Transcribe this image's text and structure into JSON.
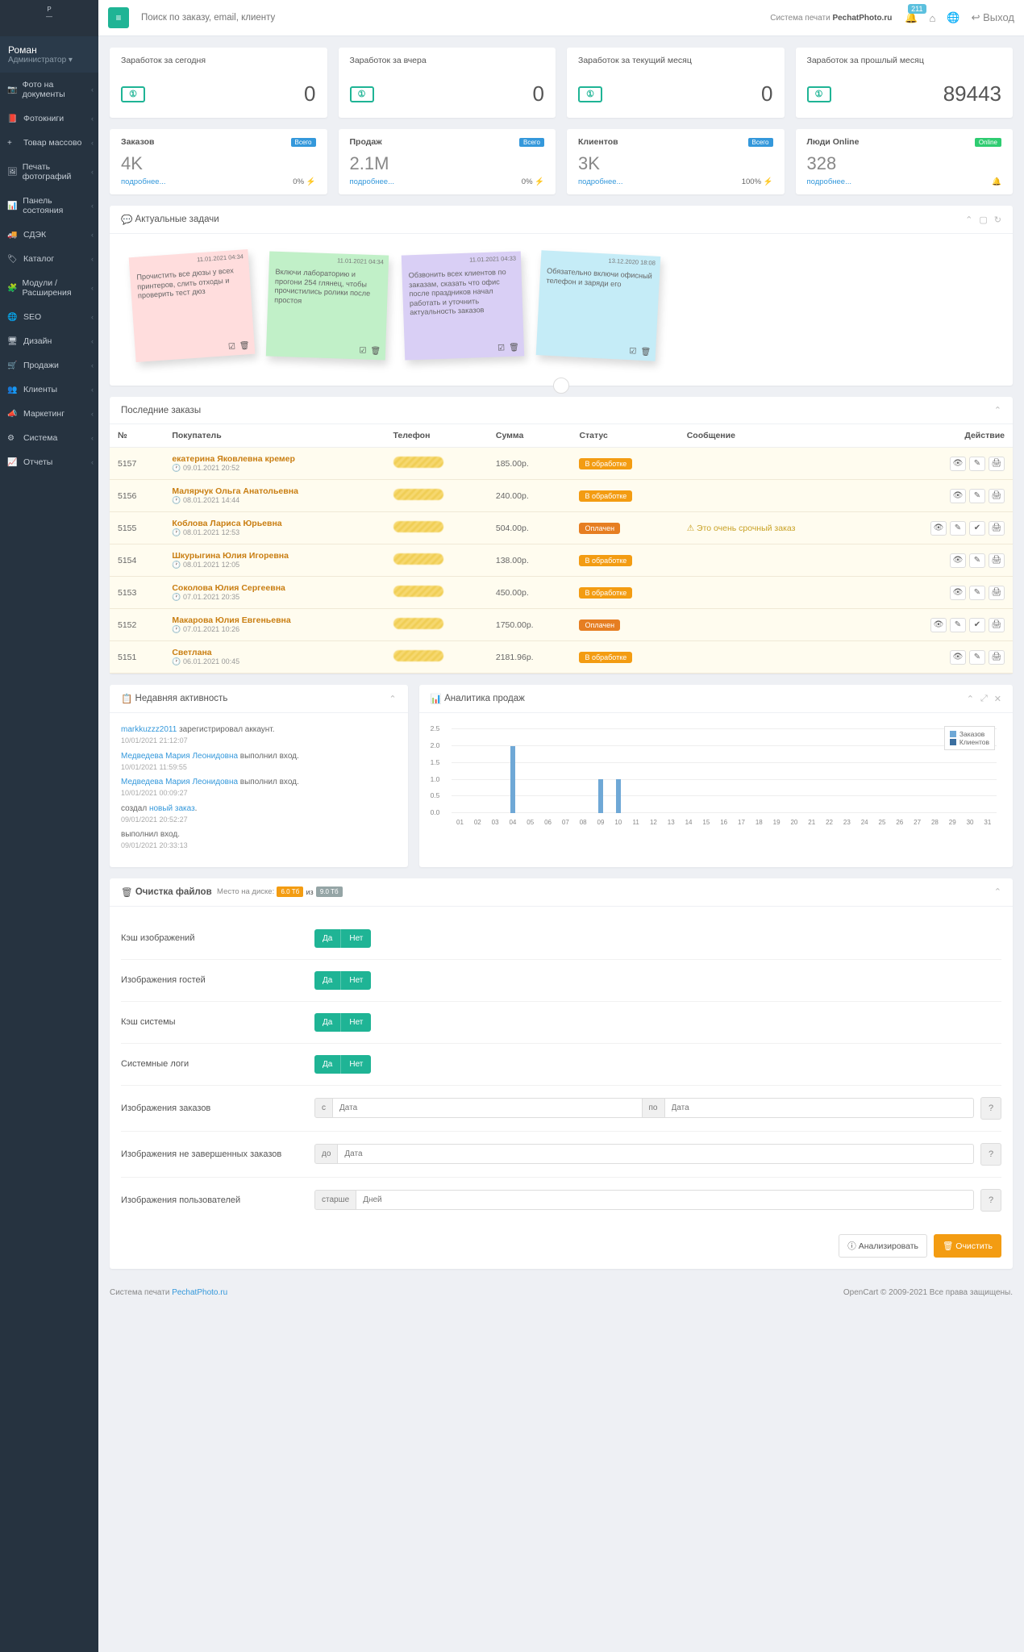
{
  "header": {
    "search_placeholder": "Поиск по заказу, email, клиенту",
    "system_label": "Система печати",
    "site": "PechatPhoto.ru",
    "notif_count": "211",
    "logout": "Выход"
  },
  "sidebar": {
    "user_name": "Роман",
    "user_role": "Администратор",
    "items": [
      {
        "label": "Фото на документы"
      },
      {
        "label": "Фотокниги"
      },
      {
        "label": "Товар массово"
      },
      {
        "label": "Печать фотографий"
      },
      {
        "label": "Панель состояния"
      },
      {
        "label": "СДЭК"
      },
      {
        "label": "Каталог"
      },
      {
        "label": "Модули / Расширения"
      },
      {
        "label": "SEO"
      },
      {
        "label": "Дизайн"
      },
      {
        "label": "Продажи"
      },
      {
        "label": "Клиенты"
      },
      {
        "label": "Маркетинг"
      },
      {
        "label": "Система"
      },
      {
        "label": "Отчеты"
      }
    ]
  },
  "stats_money": [
    {
      "title": "Заработок за сегодня",
      "value": "0"
    },
    {
      "title": "Заработок за вчера",
      "value": "0"
    },
    {
      "title": "Заработок за текущий месяц",
      "value": "0"
    },
    {
      "title": "Заработок за прошлый месяц",
      "value": "89443"
    }
  ],
  "stats_meta": [
    {
      "title": "Заказов",
      "chip": "Всего",
      "chip_cls": "chip-blue",
      "value": "4K",
      "more": "подробнее...",
      "pct": "0%"
    },
    {
      "title": "Продаж",
      "chip": "Всего",
      "chip_cls": "chip-blue",
      "value": "2.1M",
      "more": "подробнее...",
      "pct": "0%"
    },
    {
      "title": "Клиентов",
      "chip": "Всего",
      "chip_cls": "chip-blue",
      "value": "3K",
      "more": "подробнее...",
      "pct": "100%"
    },
    {
      "title": "Люди Online",
      "chip": "Online",
      "chip_cls": "chip-green",
      "value": "328",
      "more": "подробнее...",
      "pct": ""
    }
  ],
  "tasks": {
    "title": "Актуальные задачи",
    "notes": [
      {
        "cls": "r",
        "date": "11.01.2021 04:34",
        "text": "Прочистить все дюзы у всех принтеров, слить отходы и проверить тест дюз"
      },
      {
        "cls": "g",
        "date": "11.01.2021 04:34",
        "text": "Включи лабораторию и прогони 254 глянец, чтобы прочистились ролики после простоя"
      },
      {
        "cls": "p",
        "date": "11.01.2021 04:33",
        "text": "Обзвонить всех клиентов по заказам, сказать что офис после праздников начал работать и уточнить актуальность заказов"
      },
      {
        "cls": "b",
        "date": "13.12.2020 18:08",
        "text": "Обязательно включи офисный телефон и заряди его"
      }
    ]
  },
  "orders": {
    "title": "Последние заказы",
    "cols": [
      "№",
      "Покупатель",
      "Телефон",
      "Сумма",
      "Статус",
      "Сообщение",
      "Действие"
    ],
    "rows": [
      {
        "n": "5157",
        "cust": "екатерина Яковлевна кремер",
        "dt": "09.01.2021 20:52",
        "sum": "185.00р.",
        "st": "В обработке",
        "st_cls": "st-proc",
        "msg": "",
        "extra": false
      },
      {
        "n": "5156",
        "cust": "Малярчук Ольга Анатольевна",
        "dt": "08.01.2021 14:44",
        "sum": "240.00р.",
        "st": "В обработке",
        "st_cls": "st-proc",
        "msg": "",
        "extra": false
      },
      {
        "n": "5155",
        "cust": "Коблова Лариса Юрьевна",
        "dt": "08.01.2021 12:53",
        "sum": "504.00р.",
        "st": "Оплачен",
        "st_cls": "st-paid",
        "msg": "Это очень срочный заказ",
        "extra": true
      },
      {
        "n": "5154",
        "cust": "Шкурыгина Юлия Игоревна",
        "dt": "08.01.2021 12:05",
        "sum": "138.00р.",
        "st": "В обработке",
        "st_cls": "st-proc",
        "msg": "",
        "extra": false
      },
      {
        "n": "5153",
        "cust": "Соколова Юлия Сергеевна",
        "dt": "07.01.2021 20:35",
        "sum": "450.00р.",
        "st": "В обработке",
        "st_cls": "st-proc",
        "msg": "",
        "extra": false
      },
      {
        "n": "5152",
        "cust": "Макарова Юлия Евгеньевна",
        "dt": "07.01.2021 10:26",
        "sum": "1750.00р.",
        "st": "Оплачен",
        "st_cls": "st-paid",
        "msg": "",
        "extra": true
      },
      {
        "n": "5151",
        "cust": "Светлана",
        "dt": "06.01.2021 00:45",
        "sum": "2181.96р.",
        "st": "В обработке",
        "st_cls": "st-proc",
        "msg": "",
        "extra": false
      }
    ]
  },
  "activity": {
    "title": "Недавняя активность",
    "items": [
      {
        "html": [
          "markkuzzz2011",
          " зарегистрировал аккаунт."
        ],
        "ts": "10/01/2021 21:12:07"
      },
      {
        "html": [
          "Медведева Мария Леонидовна",
          " выполнил вход."
        ],
        "ts": "10/01/2021 11:59:55"
      },
      {
        "html": [
          "Медведева Мария Леонидовна",
          " выполнил вход."
        ],
        "ts": "10/01/2021 00:09:27"
      },
      {
        "html": [
          "",
          "создал ",
          "новый заказ",
          "."
        ],
        "ts": "09/01/2021 20:52:27"
      },
      {
        "html": [
          "",
          "выполнил вход."
        ],
        "ts": "09/01/2021 20:33:13"
      }
    ]
  },
  "analytics_title": "Аналитика продаж",
  "chart_data": {
    "type": "bar",
    "title": "Аналитика продаж",
    "xlabel": "",
    "ylabel": "",
    "ylim": [
      0,
      2.5
    ],
    "categories": [
      "01",
      "02",
      "03",
      "04",
      "05",
      "06",
      "07",
      "08",
      "09",
      "10",
      "11",
      "12",
      "13",
      "14",
      "15",
      "16",
      "17",
      "18",
      "19",
      "20",
      "21",
      "22",
      "23",
      "24",
      "25",
      "26",
      "27",
      "28",
      "29",
      "30",
      "31"
    ],
    "series": [
      {
        "name": "Заказов",
        "color": "#6fa8d6",
        "values": [
          0,
          0,
          0,
          2,
          0,
          0,
          0,
          0,
          1,
          1,
          0,
          0,
          0,
          0,
          0,
          0,
          0,
          0,
          0,
          0,
          0,
          0,
          0,
          0,
          0,
          0,
          0,
          0,
          0,
          0,
          0
        ]
      },
      {
        "name": "Клиентов",
        "color": "#3b6fa0",
        "values": [
          0,
          0,
          0,
          0,
          0,
          0,
          0,
          0,
          0,
          0,
          0,
          0,
          0,
          0,
          0,
          0,
          0,
          0,
          0,
          0,
          0,
          0,
          0,
          0,
          0,
          0,
          0,
          0,
          0,
          0,
          0
        ]
      }
    ],
    "yticks": [
      0,
      0.5,
      1.0,
      1.5,
      2.0,
      2.5
    ]
  },
  "cleanup": {
    "title": "Очистка файлов",
    "disk_label": "Место на диске:",
    "disk_used": "6.0 Тб",
    "disk_of": "из",
    "disk_total": "9.0 Тб",
    "rows_toggle": [
      {
        "label": "Кэш изображений"
      },
      {
        "label": "Изображения гостей"
      },
      {
        "label": "Кэш системы"
      },
      {
        "label": "Системные логи"
      }
    ],
    "yes": "Да",
    "no": "Нет",
    "r_orders": "Изображения заказов",
    "addon_from": "с",
    "place_date": "Дата",
    "addon_to": "по",
    "r_unfinished": "Изображения не завершенных заказов",
    "addon_until": "до",
    "r_users": "Изображения пользователей",
    "addon_older": "старше",
    "place_days": "Дней",
    "btn_analyse": "Анализировать",
    "btn_clear": "Очистить"
  },
  "footer": {
    "system": "Система печати",
    "site": "PechatPhoto.ru",
    "copy": "OpenCart © 2009-2021 Все права защищены."
  }
}
